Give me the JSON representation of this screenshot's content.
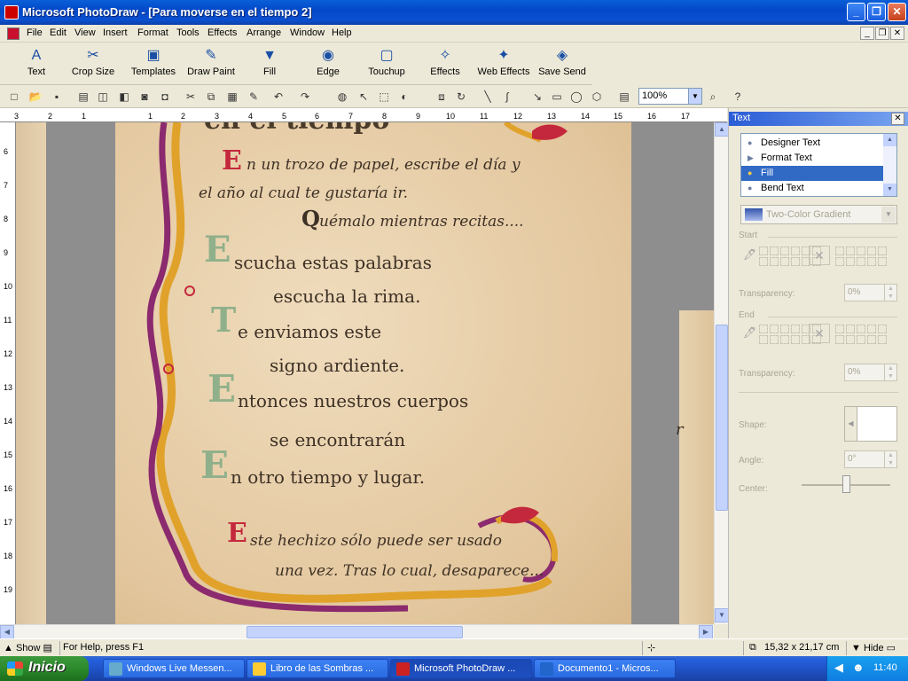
{
  "window": {
    "title": "Microsoft PhotoDraw - [Para moverse en el tiempo 2]",
    "minimize": "_",
    "maximize": "❐",
    "close": "✕"
  },
  "menu": {
    "items": [
      "File",
      "Edit",
      "View",
      "Insert",
      "Format",
      "Tools",
      "Effects",
      "Arrange",
      "Window",
      "Help"
    ],
    "mdi_min": "_",
    "mdi_restore": "❐",
    "mdi_close": "✕"
  },
  "visual_toolbar": [
    {
      "label": "Text",
      "icon": "text-icon"
    },
    {
      "label": "Crop Size",
      "icon": "crop-icon"
    },
    {
      "label": "Templates",
      "icon": "templates-icon"
    },
    {
      "label": "Draw Paint",
      "icon": "draw-paint-icon"
    },
    {
      "label": "Fill",
      "icon": "fill-icon"
    },
    {
      "label": "Edge",
      "icon": "edge-icon"
    },
    {
      "label": "Touchup",
      "icon": "touchup-icon"
    },
    {
      "label": "Effects",
      "icon": "effects-icon"
    },
    {
      "label": "Web Effects",
      "icon": "web-effects-icon"
    },
    {
      "label": "Save Send",
      "icon": "save-send-icon"
    }
  ],
  "standard_toolbar": {
    "zoom": "100%"
  },
  "ruler": {
    "top_ticks": [
      "3",
      "2",
      "1",
      "1",
      "2",
      "3",
      "4",
      "5",
      "6",
      "7",
      "8",
      "9",
      "10",
      "11",
      "12",
      "13",
      "14",
      "15",
      "16",
      "17"
    ],
    "left_ticks": [
      "6",
      "7",
      "8",
      "9",
      "10",
      "11",
      "12",
      "13",
      "14",
      "15",
      "16",
      "17",
      "18",
      "19"
    ]
  },
  "document": {
    "lines": [
      {
        "cap": "",
        "text": "en el tiempo"
      },
      {
        "cap": "E",
        "text": "n un trozo de papel, escribe el día y"
      },
      {
        "cap": "",
        "text": "el año al cual te gustaría ir."
      },
      {
        "cap": "Q",
        "text": "uémalo mientras recitas...."
      },
      {
        "cap": "E",
        "text": "scucha estas palabras"
      },
      {
        "cap": "",
        "text": "escucha la rima."
      },
      {
        "cap": "T",
        "text": "e enviamos este"
      },
      {
        "cap": "",
        "text": "signo ardiente."
      },
      {
        "cap": "E",
        "text": "ntonces nuestros cuerpos"
      },
      {
        "cap": "",
        "text": "se encontrarán"
      },
      {
        "cap": "E",
        "text": "n otro tiempo y lugar."
      },
      {
        "cap": "E",
        "text": "ste hechizo sólo puede ser usado"
      },
      {
        "cap": "",
        "text": "una vez. Tras lo cual, desaparece..."
      }
    ],
    "right_fragment": "r"
  },
  "task_pane": {
    "title": "Text",
    "close": "✕",
    "list": [
      {
        "label": "Designer Text",
        "selected": false
      },
      {
        "label": "Format Text",
        "selected": false
      },
      {
        "label": "Fill",
        "selected": true
      },
      {
        "label": "Bend Text",
        "selected": false
      }
    ],
    "fill_type": "Two-Color Gradient",
    "start_label": "Start",
    "end_label": "End",
    "transparency_label": "Transparency:",
    "start_transparency": "0%",
    "end_transparency": "0%",
    "shape_label": "Shape:",
    "angle_label": "Angle:",
    "angle_value": "0°",
    "center_label": "Center:"
  },
  "status": {
    "show": "Show",
    "help": "For Help, press F1",
    "dimensions": "15,32 x 21,17  cm",
    "hide": "Hide"
  },
  "taskbar": {
    "start": "Inicio",
    "tasks": [
      {
        "label": "Windows Live Messen...",
        "active": false
      },
      {
        "label": "Libro de las Sombras ...",
        "active": false
      },
      {
        "label": "Microsoft PhotoDraw ...",
        "active": true
      },
      {
        "label": "Documento1 - Micros...",
        "active": false
      }
    ],
    "clock": "11:40"
  }
}
